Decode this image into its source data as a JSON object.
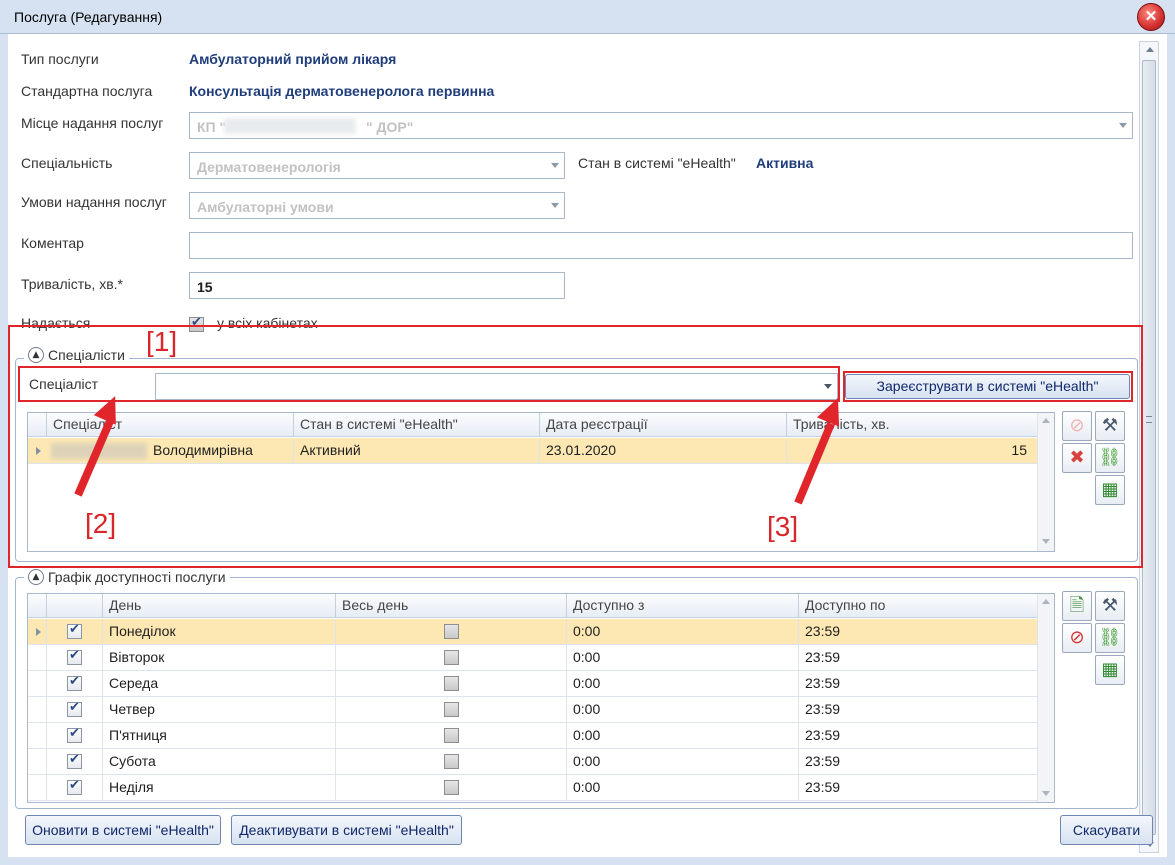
{
  "window": {
    "title": "Послуга (Редагування)",
    "close_label": "✕"
  },
  "form": {
    "service_type_label": "Тип послуги",
    "service_type_value": "Амбулаторний прийом лікаря",
    "standard_service_label": "Стандартна послуга",
    "standard_service_value": "Консультація дерматовенеролога первинна",
    "place_label": "Місце надання послуг",
    "place_value_prefix": "КП \"",
    "place_value_suffix": "\" ДОР\"",
    "specialty_label": "Спеціальність",
    "specialty_value": "Дерматовенерологія",
    "ehealth_status_label": "Стан в системі \"eHealth\"",
    "ehealth_status_value": "Активна",
    "conditions_label": "Умови надання послуг",
    "conditions_value": "Амбулаторні умови",
    "comment_label": "Коментар",
    "comment_value": "",
    "duration_label": "Тривалість, хв.*",
    "duration_value": "15",
    "provided_label": "Надається",
    "all_cabinets_label": "у всіх кабінетах",
    "all_cabinets_checked": true
  },
  "specialists": {
    "group_title": "Спеціалісти",
    "specialist_label": "Спеціаліст",
    "specialist_value": "",
    "register_button": "Зареєструвати в системі \"eHealth\"",
    "columns": [
      "Спеціаліст",
      "Стан в системі \"eHealth\"",
      "Дата реєстрації",
      "Тривалість, хв."
    ],
    "rows": [
      {
        "name": "Володимирівна",
        "status": "Активний",
        "date": "23.01.2020",
        "duration": "15"
      }
    ]
  },
  "schedule": {
    "group_title": "Графік доступності послуги",
    "columns": [
      "День",
      "Весь день",
      "Доступно з",
      "Доступно по"
    ],
    "rows": [
      {
        "day": "Понеділок",
        "from": "0:00",
        "to": "23:59"
      },
      {
        "day": "Вівторок",
        "from": "0:00",
        "to": "23:59"
      },
      {
        "day": "Середа",
        "from": "0:00",
        "to": "23:59"
      },
      {
        "day": "Четвер",
        "from": "0:00",
        "to": "23:59"
      },
      {
        "day": "П'ятниця",
        "from": "0:00",
        "to": "23:59"
      },
      {
        "day": "Субота",
        "from": "0:00",
        "to": "23:59"
      },
      {
        "day": "Неділя",
        "from": "0:00",
        "to": "23:59"
      }
    ]
  },
  "annotations": {
    "one": "[1]",
    "two": "[2]",
    "three": "[3]"
  },
  "footer": {
    "update_button": "Оновити в системі \"eHealth\"",
    "deactivate_button": "Деактивувати в системі \"eHealth\"",
    "cancel_button": "Скасувати"
  },
  "colors": {
    "accent": "#1f3d7a",
    "selection": "#fde8b4",
    "annotation_red": "#e0262b"
  },
  "icons": [
    "close-icon",
    "collapse-icon",
    "disabled-delete-icon",
    "edit-tools-icon",
    "delete-icon",
    "link-icon",
    "table-icon",
    "add-doc-icon"
  ]
}
